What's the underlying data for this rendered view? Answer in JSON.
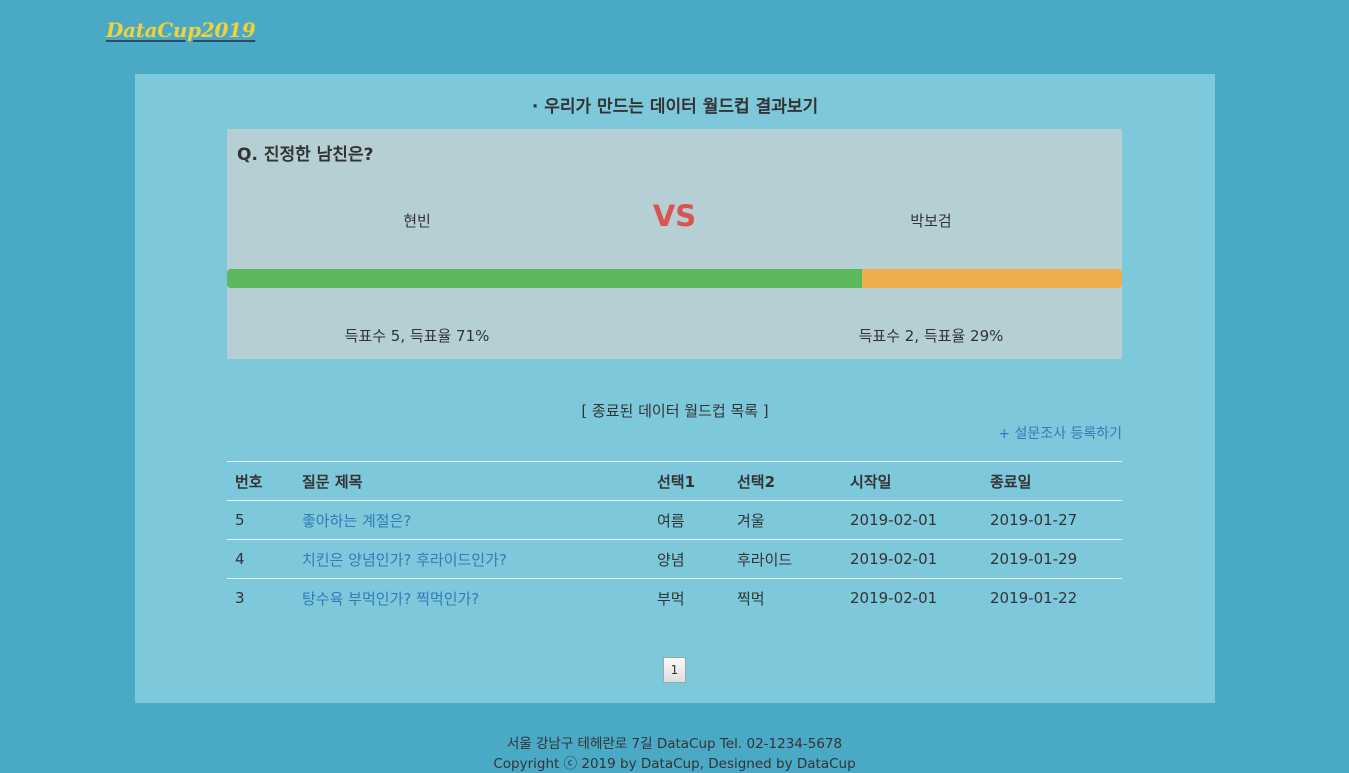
{
  "logo": "DataCup2019",
  "heading": "· 우리가 만드는 데이터 월드컵 결과보기",
  "result": {
    "question": "Q. 진정한 남친은?",
    "option_a": "현빈",
    "vs": "VS",
    "option_b": "박보검",
    "option_a_percent": 71,
    "option_b_percent": 29,
    "option_a_stat": "득표수 5, 득표율 71%",
    "option_b_stat": "득표수 2, 득표율 29%",
    "colors": {
      "a": "#5cb85c",
      "b": "#f0ad4e",
      "vs": "#d9534f"
    }
  },
  "list": {
    "title": "[ 종료된 데이터 월드컵 목록 ]",
    "register_link": "+ 설문조사 등록하기",
    "headers": [
      "번호",
      "질문 제목",
      "선택1",
      "선택2",
      "시작일",
      "종료일"
    ],
    "rows": [
      [
        "5",
        "좋아하는 계절은?",
        "여름",
        "겨울",
        "2019-02-01",
        "2019-01-27"
      ],
      [
        "4",
        "치킨은 양념인가? 후라이드인가?",
        "양념",
        "후라이드",
        "2019-02-01",
        "2019-01-29"
      ],
      [
        "3",
        "탕수육 부먹인가? 찍먹인가?",
        "부먹",
        "찍먹",
        "2019-02-01",
        "2019-01-22"
      ]
    ]
  },
  "pagination": {
    "current": "1"
  },
  "footer": {
    "line1": "서울 강남구 테헤란로 7길 DataCup Tel. 02-1234-5678",
    "line2": "Copyright ⓒ 2019 by DataCup, Designed by DataCup"
  }
}
